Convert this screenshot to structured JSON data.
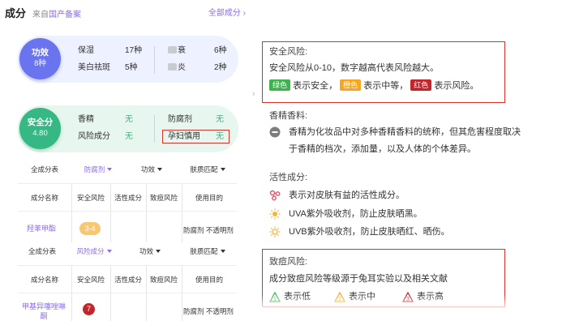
{
  "header": {
    "title": "成分",
    "source_prefix": "来自",
    "source_name": "国产备案",
    "all_link": "全部成分 ›"
  },
  "efficacy": {
    "label": "功效",
    "count": "8种",
    "items": [
      {
        "name": "保湿",
        "count": "17种"
      },
      {
        "name": "美白祛斑",
        "count": "5种"
      },
      {
        "name": "衰",
        "count": "6种"
      },
      {
        "name": "炎",
        "count": "2种"
      }
    ]
  },
  "safety": {
    "label": "安全分",
    "score": "4.80",
    "items": [
      {
        "name": "香精",
        "value": "无"
      },
      {
        "name": "风险成分",
        "value": "无"
      },
      {
        "name": "防腐剂",
        "value": "无"
      },
      {
        "name": "孕妇慎用",
        "value": "无"
      }
    ]
  },
  "table1": {
    "filters": [
      "全成分表",
      "防腐剂",
      "功效",
      "肤质匹配"
    ],
    "columns": [
      "成分名称",
      "安全风险",
      "活性成分",
      "致痘风险",
      "使用目的"
    ],
    "row": {
      "name": "羟苯甲酯",
      "risk": "3-4",
      "purpose": "防腐剂 不透明剂"
    }
  },
  "table2": {
    "filters": [
      "全成分表",
      "风险成分",
      "功效",
      "肤质匹配"
    ],
    "columns": [
      "成分名称",
      "安全风险",
      "活性成分",
      "致痘风险",
      "使用目的"
    ],
    "row": {
      "name_line1": "甲基异噻唑啉",
      "name_line2": "酮",
      "risk": "7",
      "purpose": "防腐剂 不透明剂"
    }
  },
  "legend": {
    "safety_title": "安全风险:",
    "safety_desc": "安全风险从0-10，数字越高代表风险越大。",
    "green_tag": "绿色",
    "green_text": "表示安全，",
    "orange_tag": "橙色",
    "orange_text": "表示中等，",
    "red_tag": "红色",
    "red_text": "表示风险。",
    "fragrance_title": "香精香料:",
    "fragrance_line1": "香精为化妆品中对多种香精香料的统称，但其危害程度取决",
    "fragrance_line2": "于香精的档次，添加量，以及人体的个体差异。",
    "active_title": "活性成分:",
    "active_desc": "表示对皮肤有益的活性成分。",
    "uva_desc": "UVA紫外吸收剂，防止皮肤晒黑。",
    "uvb_desc": "UVB紫外吸收剂，防止皮肤晒红、晒伤。",
    "acne_title": "致痘风险:",
    "acne_desc": "成分致痘风险等级源于兔耳实验以及相关文献",
    "acne_low": "表示低",
    "acne_mid": "表示中",
    "acne_high": "表示高"
  },
  "colors": {
    "accent": "#8b6cf0",
    "efficacy_circle": "#6a74ee",
    "safety_circle": "#35b883",
    "green_tag": "#3fb24f",
    "orange_tag": "#f5a623",
    "red_tag": "#c0272d",
    "highlight_box": "#d8322a"
  }
}
